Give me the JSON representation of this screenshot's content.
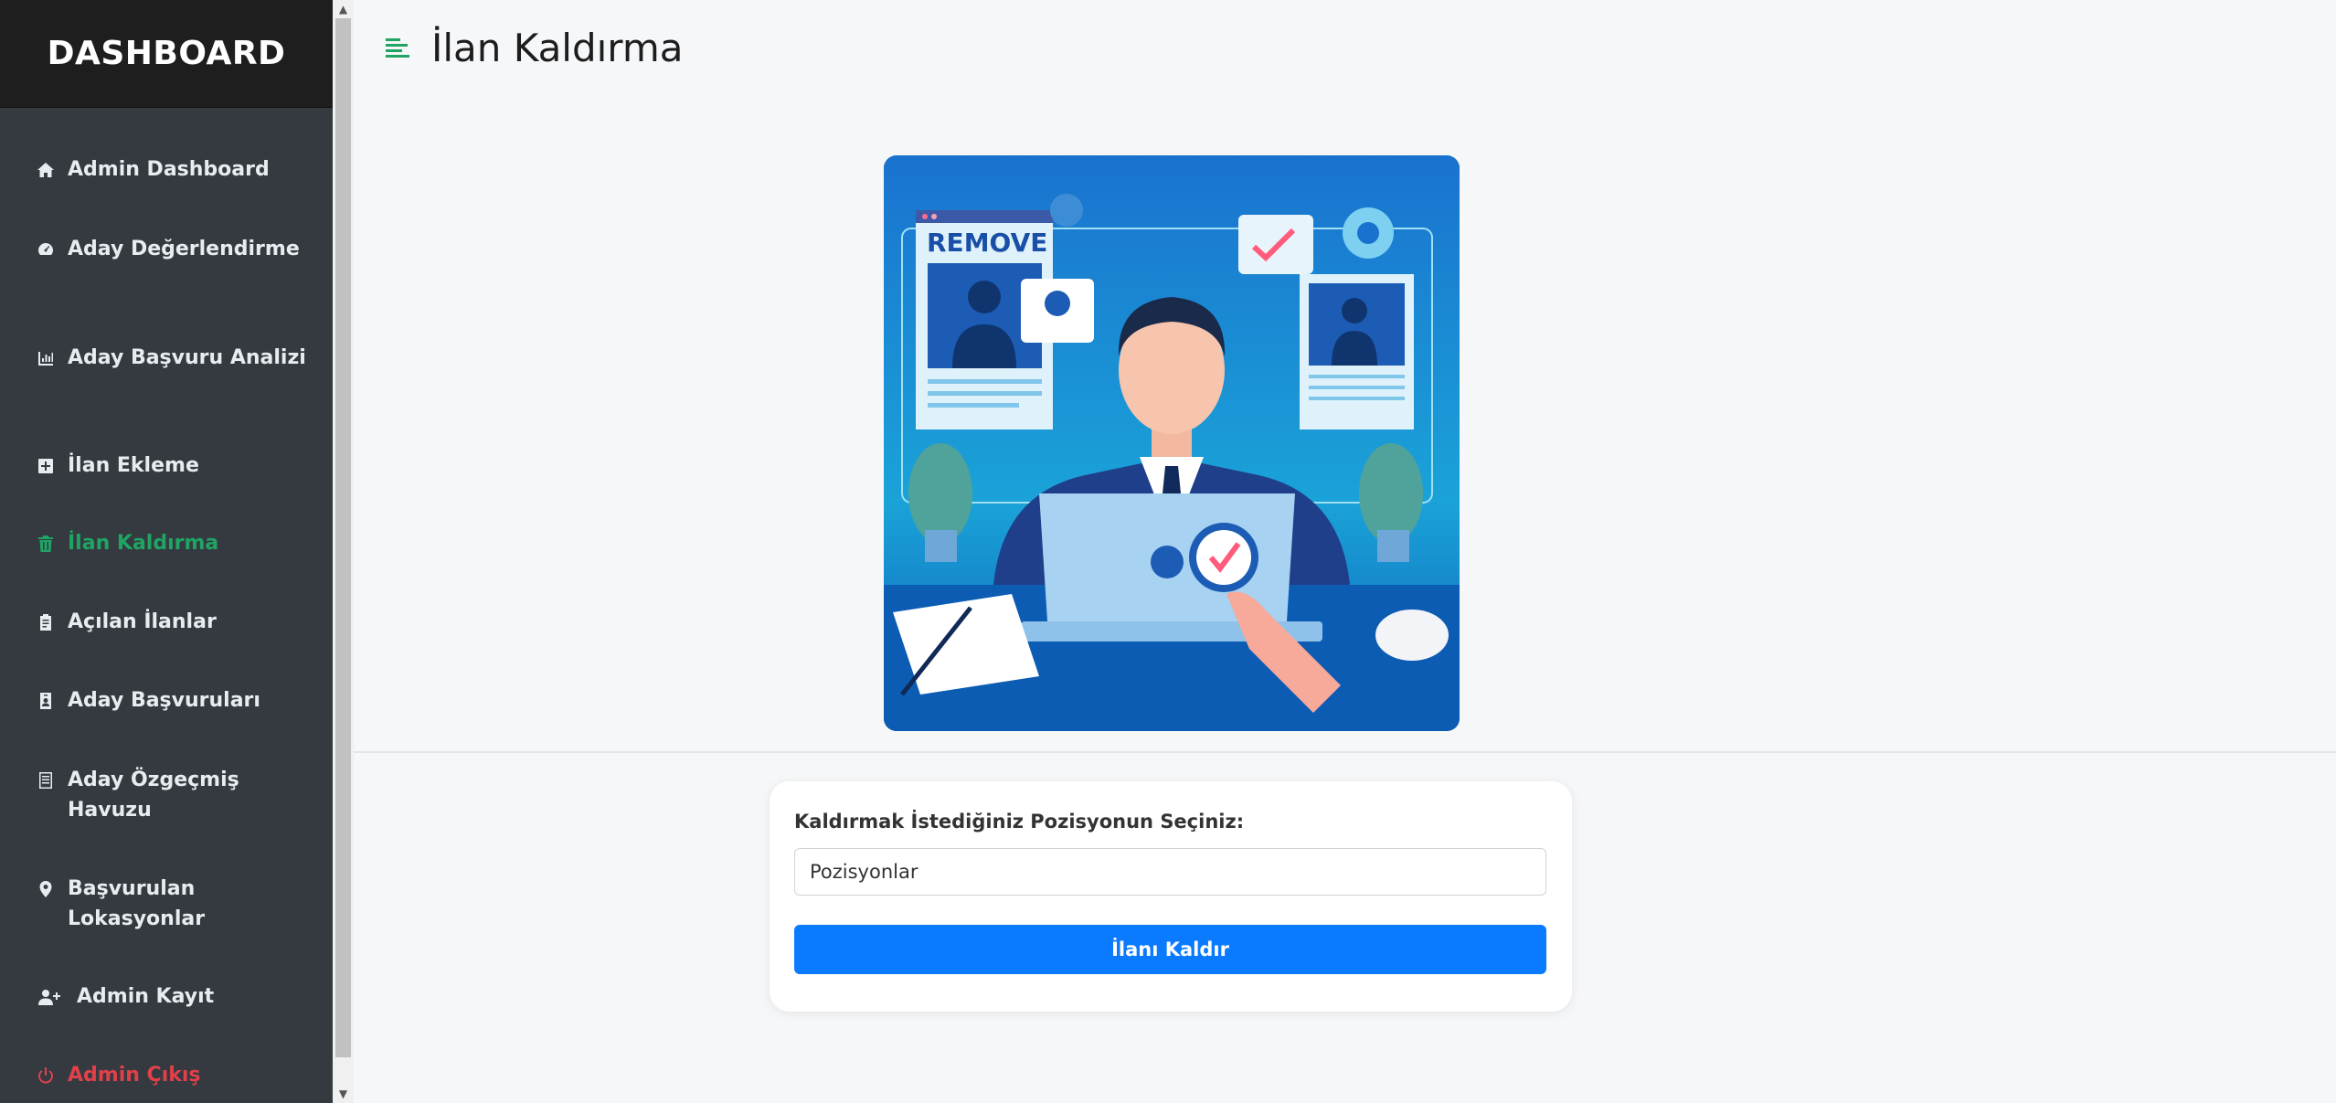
{
  "sidebar": {
    "title": "DASHBOARD",
    "items": [
      {
        "label": "Admin Dashboard",
        "icon": "home-icon"
      },
      {
        "label": "Aday Değerlendirme",
        "icon": "gauge-icon"
      },
      {
        "label": "Aday Başvuru Analizi",
        "icon": "chart-icon"
      },
      {
        "label": "İlan Ekleme",
        "icon": "plus-square-icon"
      },
      {
        "label": "İlan Kaldırma",
        "icon": "trash-icon"
      },
      {
        "label": "Açılan İlanlar",
        "icon": "clipboard-icon"
      },
      {
        "label": "Aday Başvuruları",
        "icon": "id-badge-icon"
      },
      {
        "label": "Aday Özgeçmiş Havuzu",
        "icon": "document-icon"
      },
      {
        "label": "Başvurulan Lokasyonlar",
        "icon": "map-pin-icon"
      },
      {
        "label": "Admin Kayıt",
        "icon": "user-plus-icon"
      },
      {
        "label": "Admin Çıkış",
        "icon": "power-icon"
      }
    ]
  },
  "header": {
    "title": "İlan Kaldırma"
  },
  "hero": {
    "remove_text": "REMOVE"
  },
  "form": {
    "label": "Kaldırmak İstediğiniz Pozisyonun Seçiniz:",
    "select_value": "Pozisyonlar",
    "button_label": "İlanı Kaldır"
  },
  "colors": {
    "sidebar_bg": "#343a40",
    "sidebar_header_bg": "#1e1e1e",
    "active": "#1fa463",
    "danger": "#e0404a",
    "primary_button": "#0a7bff",
    "page_bg": "#f6f7f9"
  }
}
